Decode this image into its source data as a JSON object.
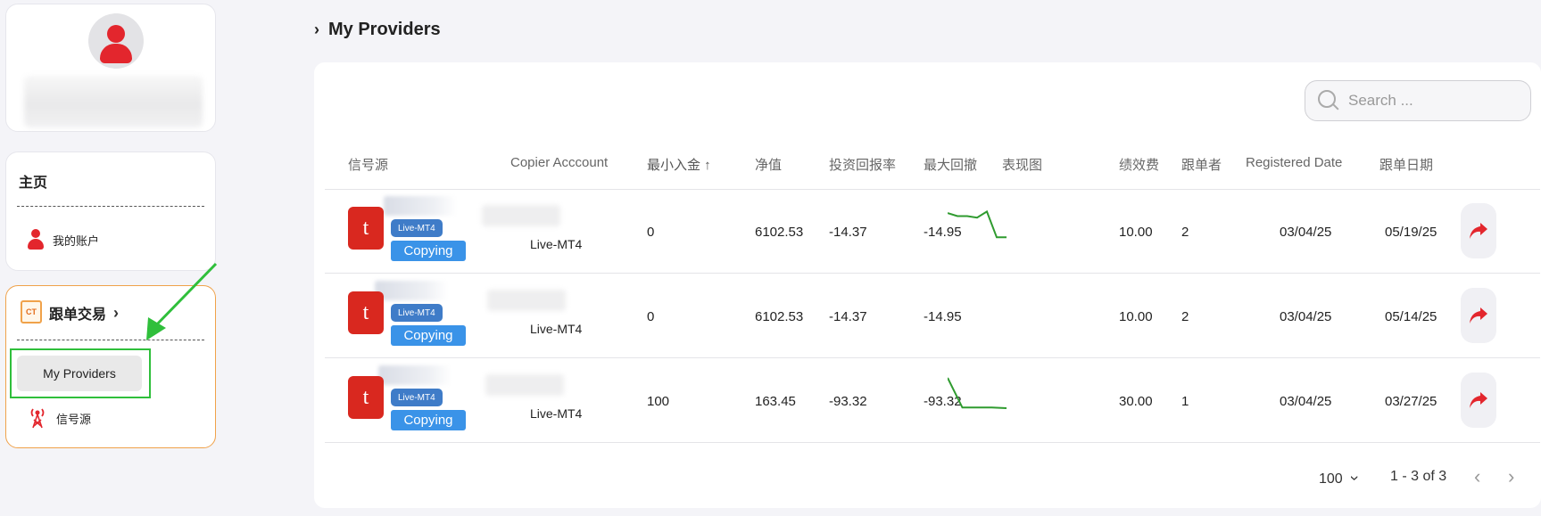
{
  "sidebar": {
    "home": {
      "title": "主页",
      "items": [
        {
          "label": "我的账户",
          "icon": "user-icon"
        }
      ]
    },
    "copy_trading": {
      "logo_text": "CT",
      "title": "跟单交易",
      "chevron": "›",
      "items": [
        {
          "label": "My Providers",
          "icon": "none",
          "active": true
        },
        {
          "label": "信号源",
          "icon": "signal-tower-icon"
        }
      ]
    }
  },
  "page": {
    "title": "My Providers",
    "chevron": "›"
  },
  "search": {
    "placeholder": "Search ..."
  },
  "table": {
    "headers": {
      "signal": "信号源",
      "copier_account": "Copier Acccount",
      "min_deposit": "最小入金 ↑",
      "equity": "净值",
      "roi": "投资回报率",
      "max_drawdown": "最大回撤",
      "chart": "表现图",
      "perf_fee": "绩效费",
      "followers": "跟单者",
      "registered_date": "Registered Date",
      "copy_date": "跟单日期"
    },
    "rows": [
      {
        "logo": "t",
        "server": "Live-MT4",
        "status": "Copying",
        "account_server": "Live-MT4",
        "min_deposit": "0",
        "equity": "6102.53",
        "roi": "-14.37",
        "max_drawdown": "-14.95",
        "spark": [
          0.85,
          0.75,
          0.75,
          0.7,
          0.9,
          0.05,
          0.05
        ],
        "perf_fee": "10.00",
        "followers": "2",
        "registered_date": "03/04/25",
        "copy_date": "05/19/25"
      },
      {
        "logo": "t",
        "server": "Live-MT4",
        "status": "Copying",
        "account_server": "Live-MT4",
        "min_deposit": "0",
        "equity": "6102.53",
        "roi": "-14.37",
        "max_drawdown": "-14.95",
        "spark": [],
        "perf_fee": "10.00",
        "followers": "2",
        "registered_date": "03/04/25",
        "copy_date": "05/14/25"
      },
      {
        "logo": "t",
        "server": "Live-MT4",
        "status": "Copying",
        "account_server": "Live-MT4",
        "min_deposit": "100",
        "equity": "163.45",
        "roi": "-93.32",
        "max_drawdown": "-93.32",
        "spark": [
          1.0,
          0.02,
          0.02,
          0.02,
          0.0
        ],
        "perf_fee": "30.00",
        "followers": "1",
        "registered_date": "03/04/25",
        "copy_date": "03/27/25"
      }
    ]
  },
  "pagination": {
    "page_size": "100",
    "range": "1 - 3 of 3",
    "prev": "‹",
    "next": "›"
  },
  "colors": {
    "accent_red": "#d9281f",
    "copy_green": "#2fbf3b",
    "badge_blue": "#3f7cc8",
    "copying_blue": "#3a93e8",
    "spark_green": "#2f9b2f"
  }
}
